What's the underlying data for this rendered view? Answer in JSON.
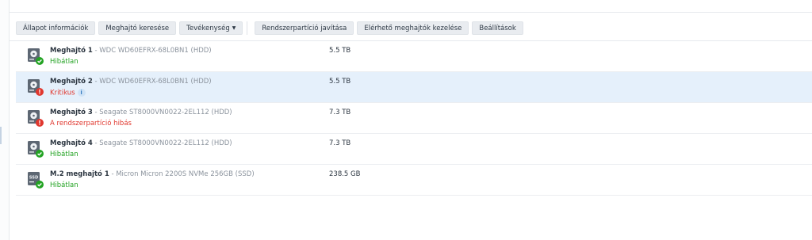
{
  "toolbar": {
    "buttons": [
      {
        "label": "Állapot információk"
      },
      {
        "label": "Meghajtó keresése"
      },
      {
        "label": "Tevékenység",
        "has_dropdown": true
      },
      {
        "label": "Rendszerpartíció javítása"
      },
      {
        "label": "Elérhető meghajtók kezelése"
      },
      {
        "label": "Beállítások"
      }
    ]
  },
  "drives": [
    {
      "name": "Meghajtó 1",
      "model": " - WDC WD60EFRX-68L0BN1 (HDD)",
      "status": "Hibátlan",
      "status_type": "ok",
      "size": "5.5 TB",
      "kind": "hdd",
      "selected": false,
      "info": false
    },
    {
      "name": "Meghajtó 2",
      "model": " - WDC WD60EFRX-68L0BN1 (HDD)",
      "status": "Kritikus",
      "status_type": "critical",
      "size": "5.5 TB",
      "kind": "hdd",
      "selected": true,
      "info": true
    },
    {
      "name": "Meghajtó 3",
      "model": " - Seagate ST8000VN0022-2EL112 (HDD)",
      "status": "A rendszerpartíció hibás",
      "status_type": "critical",
      "size": "7.3 TB",
      "kind": "hdd",
      "selected": false,
      "info": false
    },
    {
      "name": "Meghajtó 4",
      "model": " - Seagate ST8000VN0022-2EL112 (HDD)",
      "status": "Hibátlan",
      "status_type": "ok",
      "size": "7.3 TB",
      "kind": "hdd",
      "selected": false,
      "info": false
    },
    {
      "name": "M.2 meghajtó 1",
      "model": " - Micron Micron 2200S NVMe 256GB (SSD)",
      "status": "Hibátlan",
      "status_type": "ok",
      "size": "238.5 GB",
      "kind": "ssd",
      "selected": false,
      "info": false
    }
  ],
  "icons": {
    "ok_badge": "check-badge-icon",
    "critical_badge": "exclamation-badge-icon",
    "info": "info-icon",
    "hdd": "hdd-icon",
    "ssd": "ssd-icon"
  },
  "ssd_label": "SSD",
  "info_glyph": "i",
  "colors": {
    "ok": "#23a323",
    "critical": "#e0372e",
    "selected_row": "#e5f0fb"
  }
}
